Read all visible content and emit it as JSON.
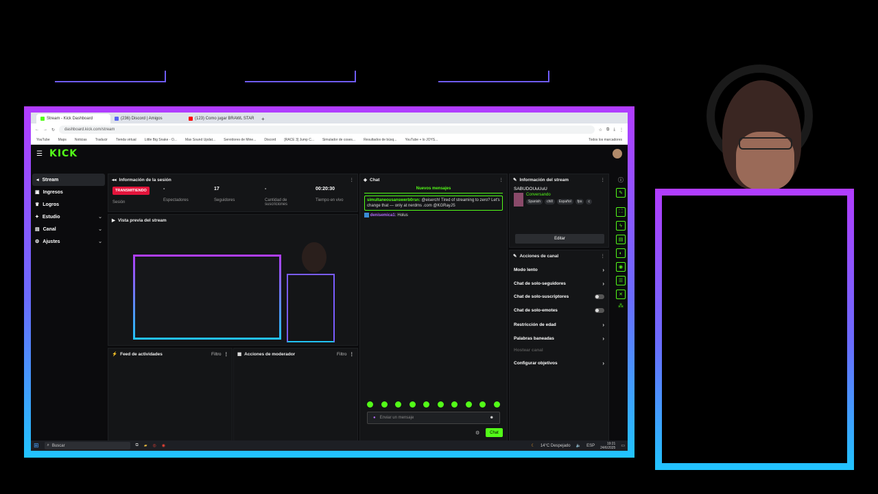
{
  "browser": {
    "tabs": [
      {
        "label": "Stream - Kick Dashboard",
        "color": "#53fc18"
      },
      {
        "label": "(236) Discord | Amigos",
        "color": "#5865f2"
      },
      {
        "label": "(123) Como jugar BRAWL STAR",
        "color": "#ff0000"
      }
    ],
    "new_tab": "+",
    "url": "dashboard.kick.com/stream",
    "bookmarks": [
      "YouTube",
      "Maps",
      "Noticias",
      "Traducir",
      "Tienda virtual",
      "Little Big Snake - O...",
      "Max Sound  Updat...",
      "Servidores de Mine...",
      "Discord",
      "[RACE 3] Jump C...",
      "Simulador de coses...",
      "Resultados de búsq...",
      "YouTube + lo JOYS..."
    ],
    "bookmarks_folder": "Todos los marcadores"
  },
  "kick": {
    "logo": "KICK",
    "sidebar": [
      {
        "label": "Stream",
        "icon": "stream-icon",
        "selected": true
      },
      {
        "label": "Ingresos",
        "icon": "income-icon"
      },
      {
        "label": "Logros",
        "icon": "trophy-icon"
      },
      {
        "label": "Estudio",
        "icon": "studio-icon",
        "chevron": true
      },
      {
        "label": "Canal",
        "icon": "channel-icon",
        "chevron": true
      },
      {
        "label": "Ajustes",
        "icon": "gear-icon",
        "chevron": true
      }
    ],
    "session": {
      "title": "Información de la sesión",
      "status": "TRANSMITIENDO",
      "session_label": "Sesión",
      "viewers_value": "-",
      "viewers_label": "Espectadores",
      "followers_value": "17",
      "followers_label": "Seguidores",
      "subs_value": "-",
      "subs_label": "Cantidad de suscriciones",
      "time_value": "00:20:30",
      "time_label": "Tiempo en vivo"
    },
    "preview": {
      "title": "Vista previa del stream"
    },
    "activity": {
      "title": "Feed de actividades",
      "filter": "Filtro"
    },
    "moderator": {
      "title": "Acciones de moderador",
      "filter": "Filtro"
    },
    "chat": {
      "title": "Chat",
      "new_messages": "Nuevos mensajes",
      "pinned_user": "simultaneousanswerb0rsn:",
      "pinned_text": "@eiserch! Tired of streaming to zero? Let's change that — only at nerdms .com @KGRayJS",
      "msg_user": "denisemica1:",
      "msg_text": "Holus",
      "placeholder": "Enviar un mensaje",
      "send": "Chat"
    },
    "stream_info": {
      "title": "Información del stream",
      "stream_title": "SABUDOUuUuU",
      "category": "Conversando",
      "tags": [
        "Spanish",
        "chill",
        "Español",
        "fps",
        "c"
      ],
      "edit": "Editar"
    },
    "channel_actions": {
      "title": "Acciones de canal",
      "items": [
        {
          "label": "Modo lento",
          "control": "arrow"
        },
        {
          "label": "Chat de solo-seguidores",
          "control": "arrow"
        },
        {
          "label": "Chat de solo-suscriptores",
          "control": "toggle"
        },
        {
          "label": "Chat de solo-emotes",
          "control": "toggle"
        },
        {
          "label": "Restricción de edad",
          "control": "arrow"
        },
        {
          "label": "Palabras baneadas",
          "control": "arrow"
        },
        {
          "label": "Hostear canal",
          "control": "disabled"
        },
        {
          "label": "Configurar objetivos",
          "control": "arrow"
        }
      ]
    }
  },
  "taskbar": {
    "search": "Buscar",
    "weather": "14°C  Despejado",
    "lang": "ESP",
    "time": "19:21",
    "date": "24/6/2025"
  },
  "colors": {
    "kick_green": "#53fc18",
    "live_red": "#e3143b",
    "frame_top": "#b23cff",
    "frame_bottom": "#21c4ff"
  }
}
